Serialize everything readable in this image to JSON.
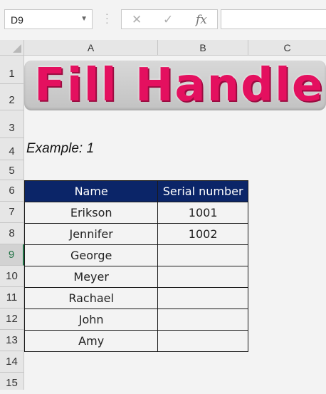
{
  "name_box": {
    "value": "D9"
  },
  "formula_bar": {
    "cancel_icon": "✕",
    "enter_icon": "✓",
    "fx_label": "fx",
    "content": ""
  },
  "columns": [
    "A",
    "B",
    "C"
  ],
  "rows": [
    "1",
    "2",
    "3",
    "4",
    "5",
    "6",
    "7",
    "8",
    "9",
    "10",
    "11",
    "12",
    "13",
    "14",
    "15"
  ],
  "active_row": "9",
  "banner": {
    "text": "Fill Handle"
  },
  "example_label": "Example: 1",
  "table": {
    "headers": [
      "Name",
      "Serial number"
    ],
    "rows": [
      [
        "Erikson",
        "1001"
      ],
      [
        "Jennifer",
        "1002"
      ],
      [
        "George",
        ""
      ],
      [
        "Meyer",
        ""
      ],
      [
        "Rachael",
        ""
      ],
      [
        "John",
        ""
      ],
      [
        "Amy",
        ""
      ]
    ]
  },
  "colors": {
    "header_fill": "#0b2568",
    "banner_text": "#e4105f",
    "selection": "#217346"
  }
}
